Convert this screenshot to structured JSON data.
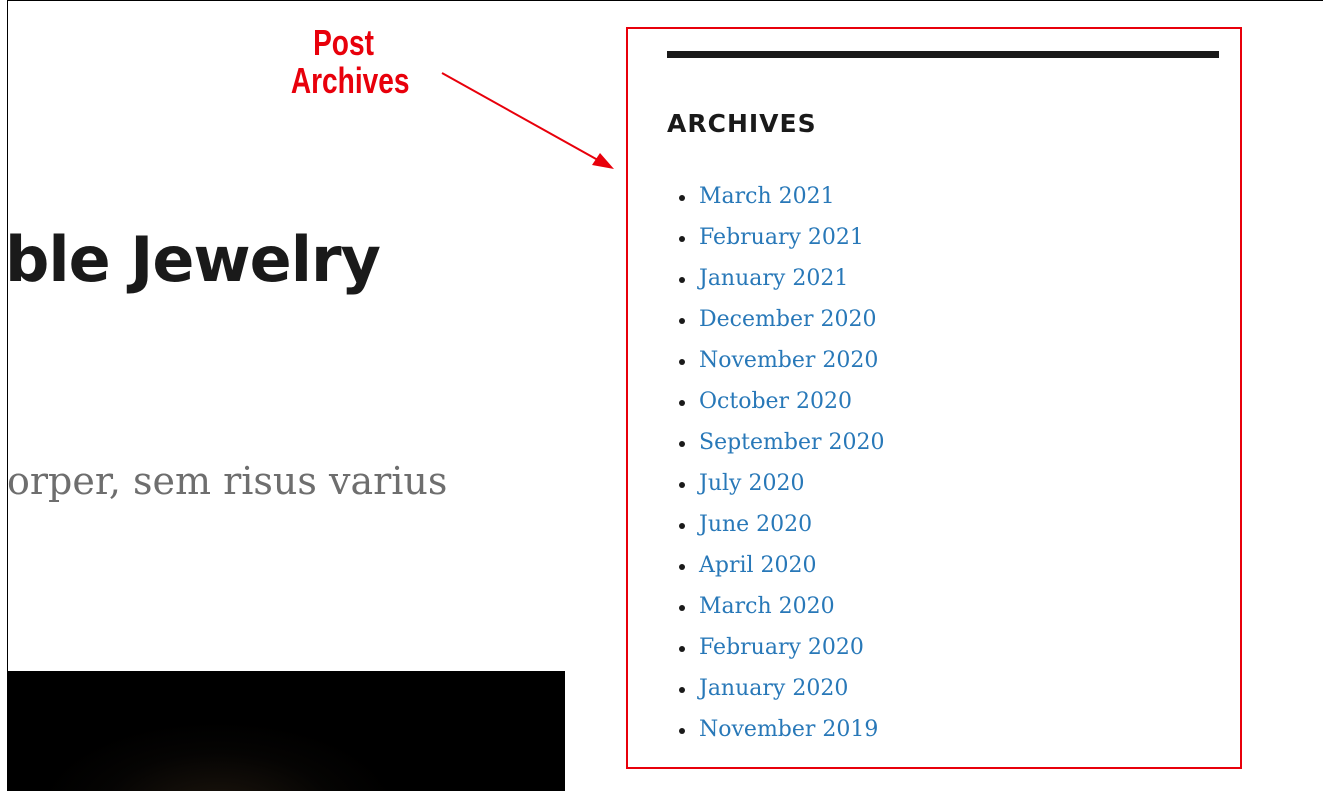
{
  "post": {
    "title": "ble Jewelry",
    "excerpt": "orper, sem risus varius"
  },
  "annotation": {
    "line1": "Post",
    "line2": "Archives",
    "color": "#e8000b"
  },
  "widget": {
    "title": "ARCHIVES",
    "items": [
      {
        "label": "March 2021"
      },
      {
        "label": "February 2021"
      },
      {
        "label": "January 2021"
      },
      {
        "label": "December 2020"
      },
      {
        "label": "November 2020"
      },
      {
        "label": "October 2020"
      },
      {
        "label": "September 2020"
      },
      {
        "label": "July 2020"
      },
      {
        "label": "June 2020"
      },
      {
        "label": "April 2020"
      },
      {
        "label": "March 2020"
      },
      {
        "label": "February 2020"
      },
      {
        "label": "January 2020"
      },
      {
        "label": "November 2019"
      }
    ]
  },
  "colors": {
    "link": "#2878b8",
    "text": "#1a1a1a",
    "muted": "#6e6e6e"
  }
}
